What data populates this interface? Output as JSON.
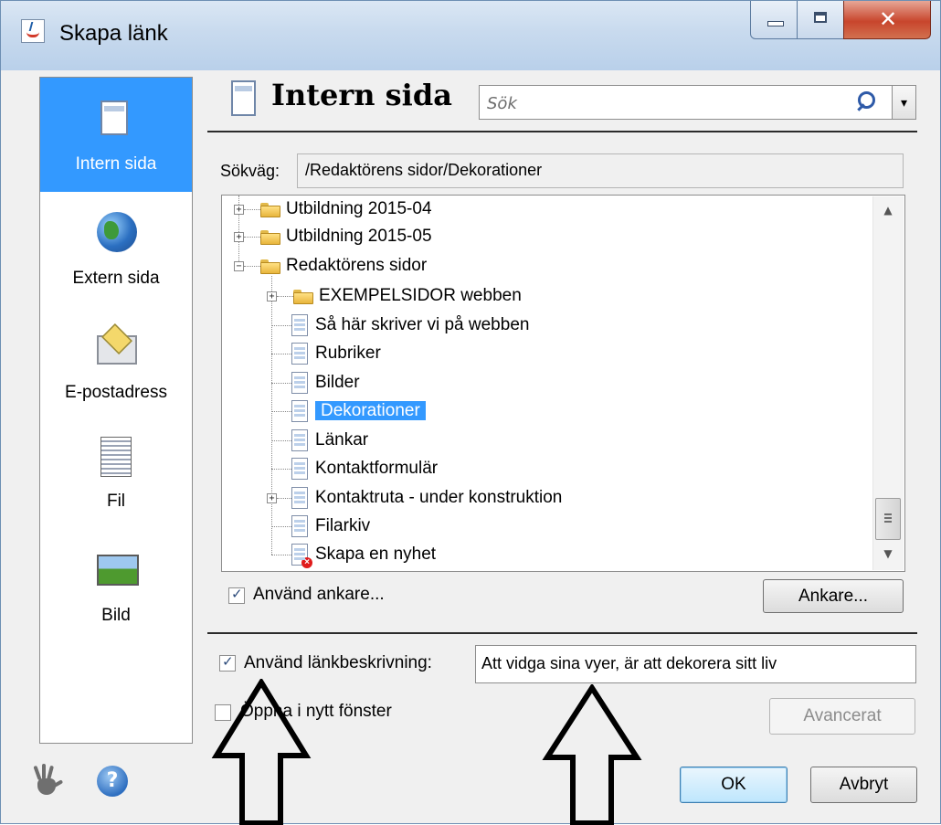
{
  "window": {
    "title": "Skapa länk"
  },
  "sidebar": {
    "items": [
      {
        "label": "Intern sida",
        "icon": "page-icon",
        "active": true
      },
      {
        "label": "Extern sida",
        "icon": "globe-icon",
        "active": false
      },
      {
        "label": "E-postadress",
        "icon": "envelope-icon",
        "active": false
      },
      {
        "label": "Fil",
        "icon": "file-icon",
        "active": false
      },
      {
        "label": "Bild",
        "icon": "image-icon",
        "active": false
      }
    ]
  },
  "header": {
    "title": "Intern sida",
    "search_placeholder": "Sök"
  },
  "path": {
    "label": "Sökväg:",
    "value": "/Redaktörens sidor/Dekorationer"
  },
  "tree": {
    "items": [
      {
        "label": "Utbildning 2015-04",
        "type": "folder",
        "level": 0,
        "expander": "+"
      },
      {
        "label": "Utbildning 2015-05",
        "type": "folder",
        "level": 0,
        "expander": "+"
      },
      {
        "label": "Redaktörens sidor",
        "type": "folder",
        "level": 0,
        "expander": "−"
      },
      {
        "label": "EXEMPELSIDOR webben",
        "type": "folder",
        "level": 1,
        "expander": "+"
      },
      {
        "label": "Så här skriver vi på webben",
        "type": "page",
        "level": 1
      },
      {
        "label": "Rubriker",
        "type": "page",
        "level": 1
      },
      {
        "label": "Bilder",
        "type": "page",
        "level": 1
      },
      {
        "label": "Dekorationer",
        "type": "page",
        "level": 1,
        "selected": true
      },
      {
        "label": "Länkar",
        "type": "page",
        "level": 1
      },
      {
        "label": "Kontaktformulär",
        "type": "page",
        "level": 1
      },
      {
        "label": "Kontaktruta - under konstruktion",
        "type": "page",
        "level": 1,
        "expander": "+"
      },
      {
        "label": "Filarkiv",
        "type": "page",
        "level": 1
      },
      {
        "label": "Skapa en nyhet",
        "type": "page-error",
        "level": 1
      }
    ]
  },
  "anchor": {
    "checkbox_label": "Använd ankare...",
    "checked": true,
    "button_label": "Ankare..."
  },
  "description": {
    "checkbox_label": "Använd länkbeskrivning:",
    "checked": true,
    "value": "Att vidga sina vyer, är att dekorera sitt liv"
  },
  "new_window": {
    "checkbox_label": "Öppna i nytt fönster",
    "checked": false
  },
  "buttons": {
    "advanced": "Avancerat",
    "ok": "OK",
    "cancel": "Avbryt"
  },
  "colors": {
    "selection": "#3399ff",
    "dialog_bg": "#f0f0f0"
  }
}
